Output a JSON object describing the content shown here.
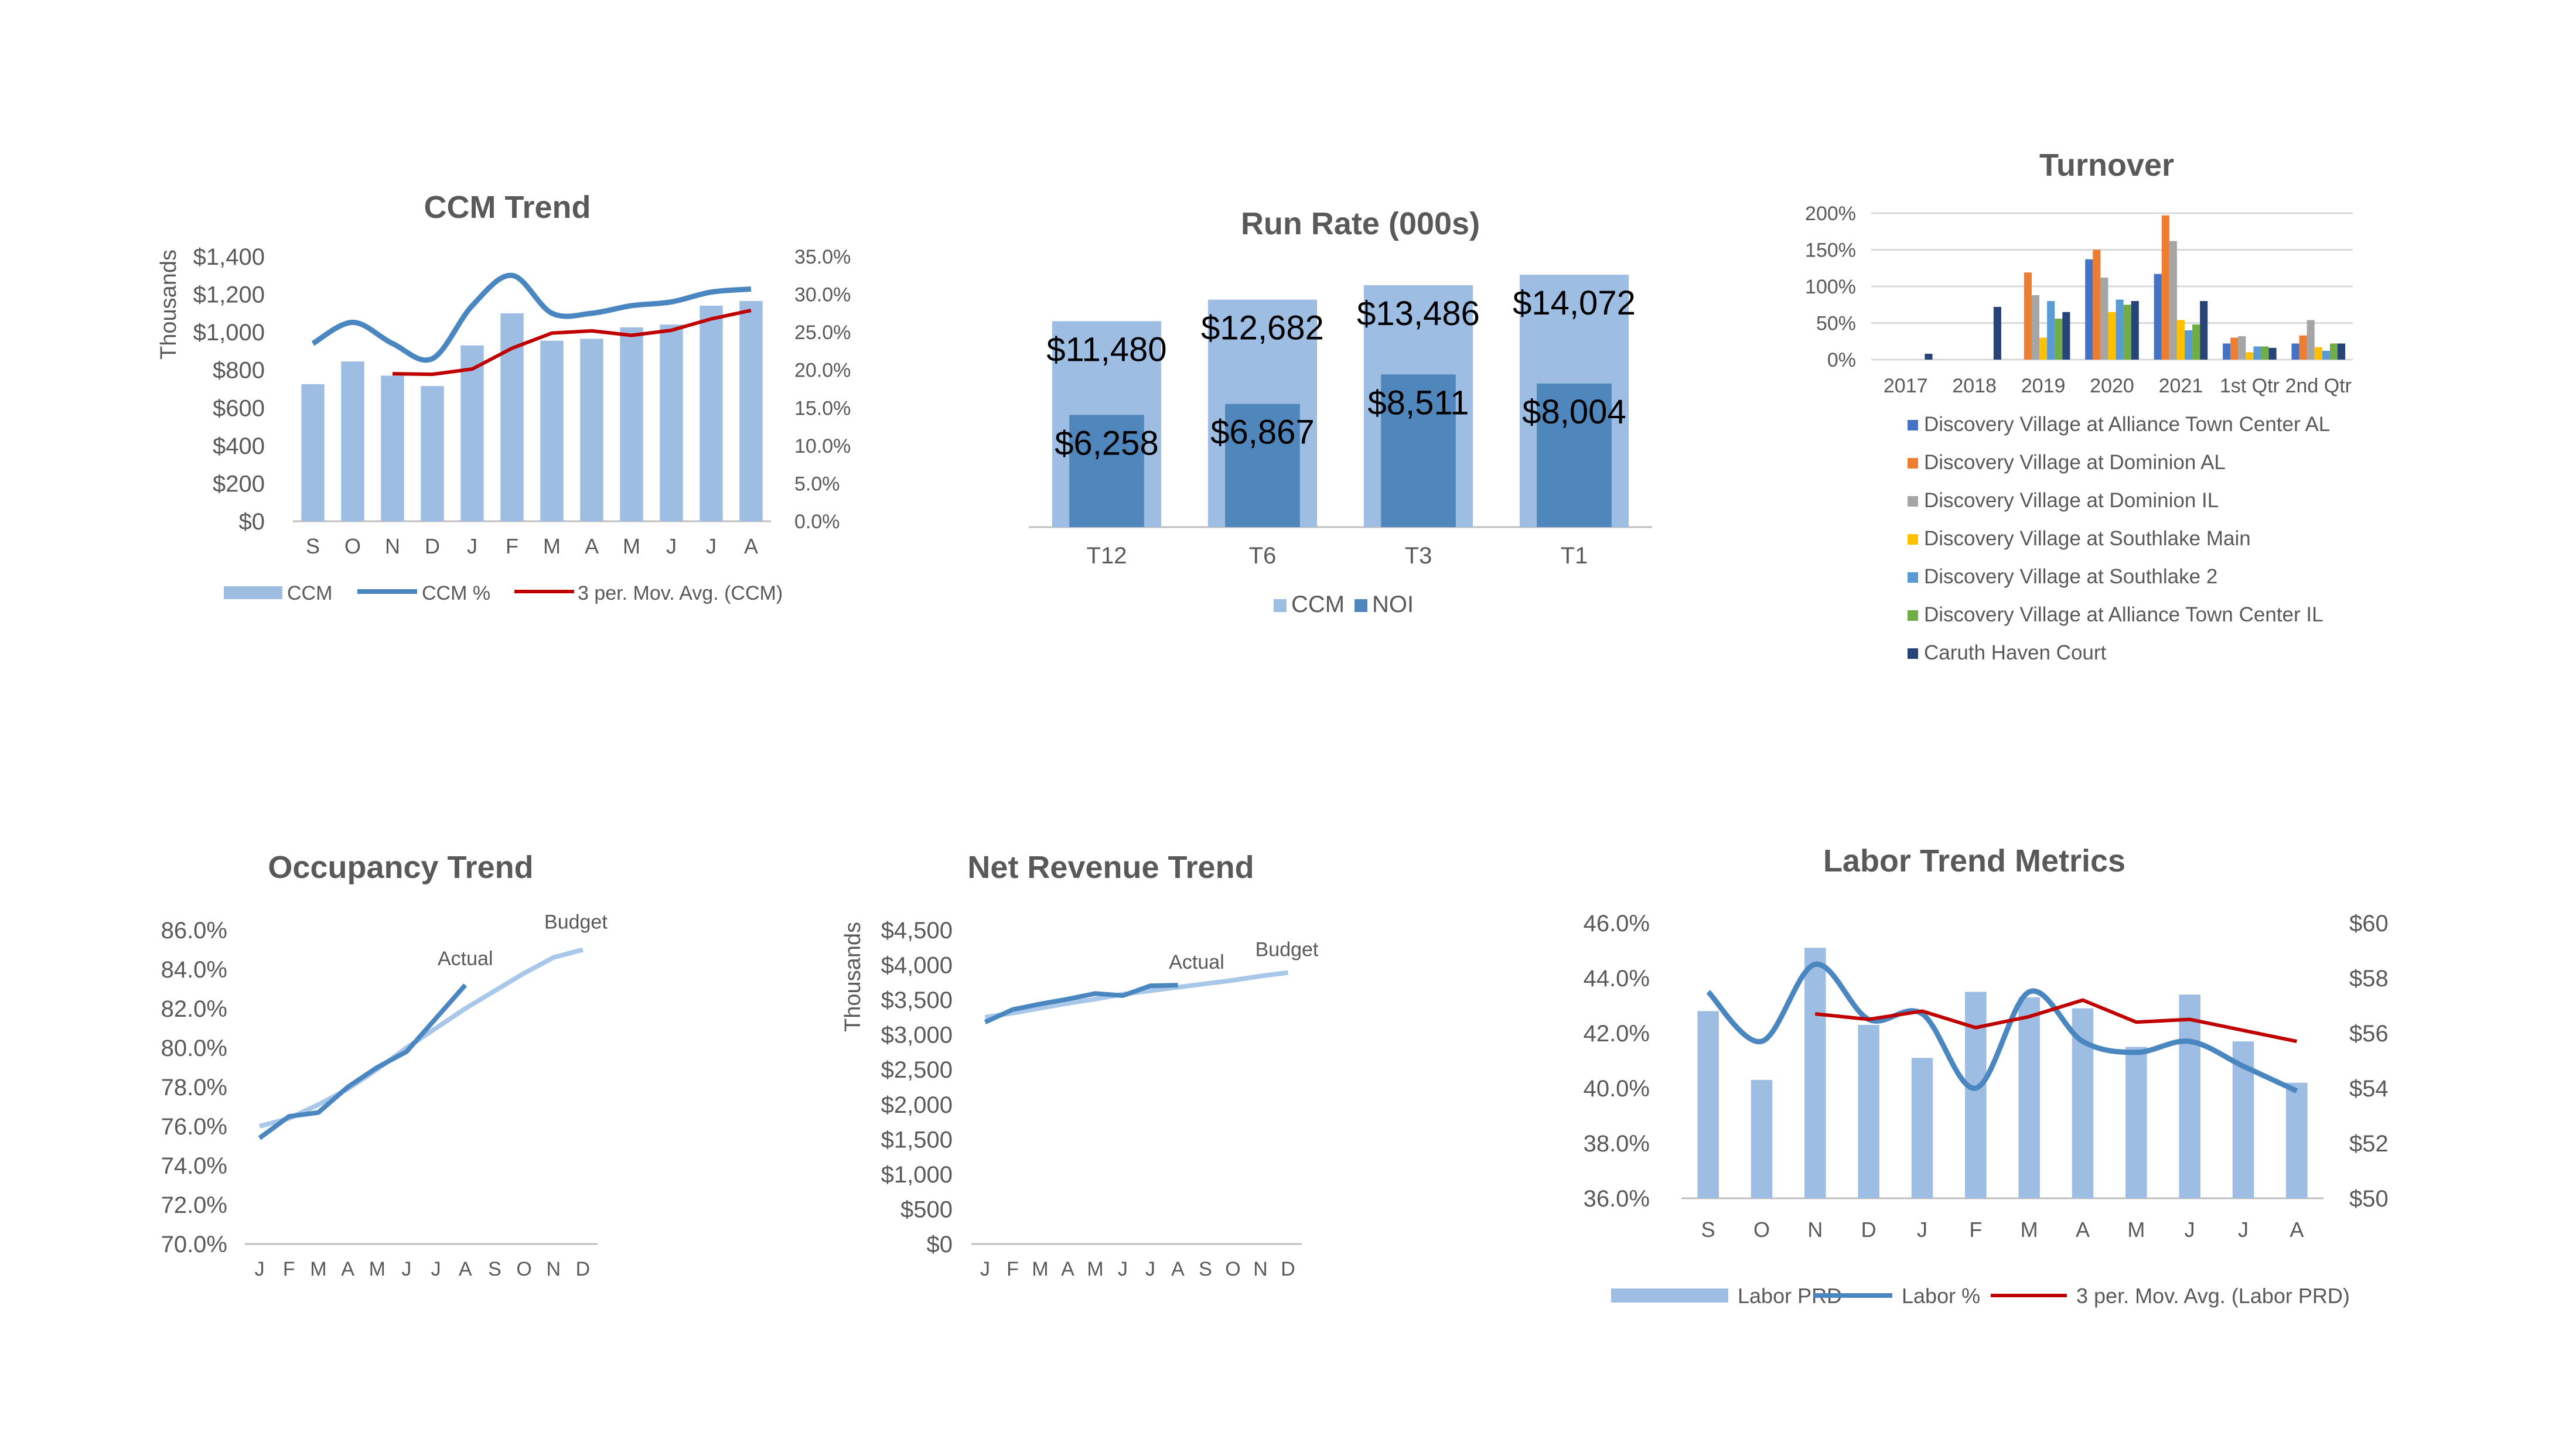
{
  "colors": {
    "bar_light": "#9dbde3",
    "line_blue": "#4a86c0",
    "noi_blue": "#4f86bb",
    "mov_avg_red": "#c00000",
    "budget_line": "#a9c7e8",
    "text": "#595959"
  },
  "chart_data": [
    {
      "id": "ccm_trend",
      "type": "bar",
      "title": "CCM Trend",
      "ylabel": "Thousands",
      "categories": [
        "S",
        "O",
        "N",
        "D",
        "J",
        "F",
        "M",
        "A",
        "M",
        "J",
        "J",
        "A"
      ],
      "ylim": [
        0,
        1400
      ],
      "y_ticks": [
        "$0",
        "$200",
        "$400",
        "$600",
        "$800",
        "$1,000",
        "$1,200",
        "$1,400"
      ],
      "y2lim": [
        0,
        35
      ],
      "y2_ticks": [
        "0.0%",
        "5.0%",
        "10.0%",
        "15.0%",
        "20.0%",
        "25.0%",
        "30.0%",
        "35.0%"
      ],
      "series": [
        {
          "name": "CCM",
          "kind": "bar",
          "axis": "y",
          "values": [
            725,
            845,
            770,
            715,
            930,
            1100,
            955,
            965,
            1025,
            1040,
            1140,
            1165
          ]
        },
        {
          "name": "CCM %",
          "kind": "line",
          "axis": "y2",
          "values": [
            23.5,
            26.3,
            23.5,
            21.5,
            28.5,
            32.5,
            27.5,
            27.5,
            28.5,
            29.0,
            30.3,
            30.7
          ]
        },
        {
          "name": "3 per. Mov. Avg. (CCM)",
          "kind": "line",
          "axis": "y",
          "values": [
            null,
            null,
            780,
            777,
            805,
            915,
            995,
            1007,
            983,
            1010,
            1070,
            1115
          ]
        }
      ],
      "legend": "bottom"
    },
    {
      "id": "run_rate",
      "type": "bar",
      "title": "Run Rate (000s)",
      "categories": [
        "T12",
        "T6",
        "T3",
        "T1"
      ],
      "ylim": [
        0,
        16000
      ],
      "series": [
        {
          "name": "CCM",
          "values": [
            11480,
            12682,
            13486,
            14072
          ],
          "labels": [
            "$11,480",
            "$12,682",
            "$13,486",
            "$14,072"
          ]
        },
        {
          "name": "NOI",
          "values": [
            6258,
            6867,
            8511,
            8004
          ],
          "labels": [
            "$6,258",
            "$6,867",
            "$8,511",
            "$8,004"
          ]
        }
      ],
      "legend": "bottom"
    },
    {
      "id": "turnover",
      "type": "bar",
      "title": "Turnover",
      "categories": [
        "2017",
        "2018",
        "2019",
        "2020",
        "2021",
        "1st Qtr",
        "2nd Qtr"
      ],
      "ylim": [
        0,
        200
      ],
      "y_ticks": [
        "0%",
        "50%",
        "100%",
        "150%",
        "200%"
      ],
      "series": [
        {
          "name": "Discovery Village at Alliance Town Center AL",
          "color": "#4472c4",
          "values": [
            0,
            0,
            0,
            137,
            117,
            22,
            22
          ]
        },
        {
          "name": "Discovery Village at Dominion AL",
          "color": "#ed7d31",
          "values": [
            0,
            0,
            119,
            150,
            197,
            30,
            33
          ]
        },
        {
          "name": "Discovery Village at Dominion IL",
          "color": "#a5a5a5",
          "values": [
            0,
            0,
            88,
            112,
            162,
            32,
            54
          ]
        },
        {
          "name": "Discovery Village at Southlake Main",
          "color": "#ffc000",
          "values": [
            0,
            0,
            30,
            65,
            54,
            10,
            17
          ]
        },
        {
          "name": "Discovery Village at Southlake 2",
          "color": "#5b9bd5",
          "values": [
            0,
            0,
            80,
            82,
            40,
            18,
            12
          ]
        },
        {
          "name": "Discovery Village at Alliance Town Center IL",
          "color": "#70ad47",
          "values": [
            0,
            0,
            56,
            75,
            48,
            18,
            22
          ]
        },
        {
          "name": "Caruth Haven Court",
          "color": "#264478",
          "values": [
            8,
            72,
            65,
            80,
            80,
            16,
            22
          ]
        }
      ],
      "legend": "bottom"
    },
    {
      "id": "occupancy",
      "type": "line",
      "title": "Occupancy Trend",
      "categories": [
        "J",
        "F",
        "M",
        "A",
        "M",
        "J",
        "J",
        "A",
        "S",
        "O",
        "N",
        "D"
      ],
      "ylim": [
        70,
        86
      ],
      "y_ticks": [
        "70.0%",
        "72.0%",
        "74.0%",
        "76.0%",
        "78.0%",
        "80.0%",
        "82.0%",
        "84.0%",
        "86.0%"
      ],
      "series": [
        {
          "name": "Actual",
          "values": [
            75.4,
            76.5,
            76.7,
            78.0,
            79.0,
            79.8,
            81.5,
            83.2,
            null,
            null,
            null,
            null
          ]
        },
        {
          "name": "Budget",
          "values": [
            76.0,
            76.4,
            77.1,
            77.9,
            78.9,
            80.0,
            81.0,
            82.0,
            82.9,
            83.8,
            84.6,
            85.0
          ]
        }
      ]
    },
    {
      "id": "net_revenue",
      "type": "line",
      "title": "Net Revenue Trend",
      "ylabel": "Thousands",
      "categories": [
        "J",
        "F",
        "M",
        "A",
        "M",
        "J",
        "J",
        "A",
        "S",
        "O",
        "N",
        "D"
      ],
      "ylim": [
        0,
        4500
      ],
      "y_ticks": [
        "$0",
        "$500",
        "$1,000",
        "$1,500",
        "$2,000",
        "$2,500",
        "$3,000",
        "$3,500",
        "$4,000",
        "$4,500"
      ],
      "series": [
        {
          "name": "Actual",
          "values": [
            3180,
            3360,
            3440,
            3510,
            3590,
            3560,
            3700,
            3710,
            null,
            null,
            null,
            null
          ]
        },
        {
          "name": "Budget",
          "values": [
            3250,
            3310,
            3380,
            3450,
            3510,
            3580,
            3630,
            3680,
            3730,
            3780,
            3840,
            3890
          ]
        }
      ]
    },
    {
      "id": "labor_trend",
      "type": "bar",
      "title": "Labor Trend Metrics",
      "categories": [
        "S",
        "O",
        "N",
        "D",
        "J",
        "F",
        "M",
        "A",
        "M",
        "J",
        "J",
        "A"
      ],
      "ylim": [
        36,
        46
      ],
      "y_ticks": [
        "36.0%",
        "38.0%",
        "40.0%",
        "42.0%",
        "44.0%",
        "46.0%"
      ],
      "y2lim": [
        50,
        60
      ],
      "y2_ticks": [
        "$50",
        "$52",
        "$54",
        "$56",
        "$58",
        "$60"
      ],
      "series": [
        {
          "name": "Labor PRD",
          "kind": "bar",
          "axis": "y2",
          "values": [
            56.8,
            54.3,
            59.1,
            56.3,
            55.1,
            57.5,
            57.3,
            56.9,
            55.5,
            57.4,
            55.7,
            54.2
          ]
        },
        {
          "name": "Labor %",
          "kind": "line",
          "axis": "y",
          "values": [
            43.5,
            41.7,
            44.5,
            42.5,
            42.7,
            40.0,
            43.5,
            41.7,
            41.3,
            41.7,
            40.8,
            39.9
          ]
        },
        {
          "name": "3 per. Mov. Avg. (Labor PRD)",
          "kind": "line",
          "axis": "y2",
          "values": [
            null,
            null,
            56.7,
            56.5,
            56.8,
            56.2,
            56.6,
            57.2,
            56.4,
            56.5,
            56.1,
            55.7
          ]
        }
      ],
      "legend": "bottom"
    }
  ]
}
